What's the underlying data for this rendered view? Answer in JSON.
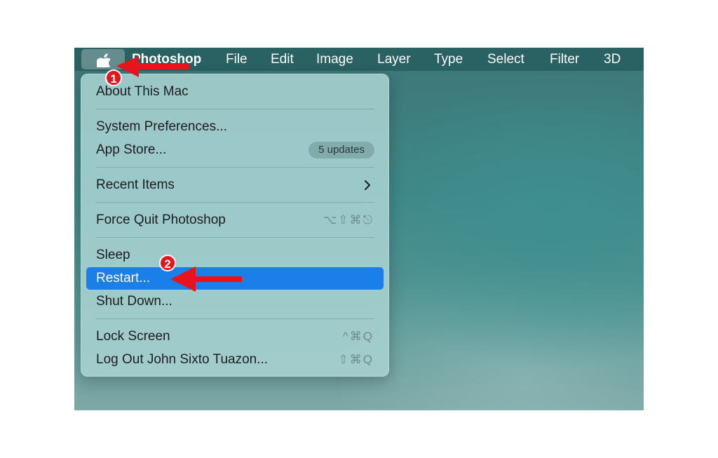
{
  "menubar": {
    "apple_icon": "apple-logo-icon",
    "app_name": "Photoshop",
    "items": [
      {
        "label": "File"
      },
      {
        "label": "Edit"
      },
      {
        "label": "Image"
      },
      {
        "label": "Layer"
      },
      {
        "label": "Type"
      },
      {
        "label": "Select"
      },
      {
        "label": "Filter"
      },
      {
        "label": "3D"
      }
    ]
  },
  "apple_menu": {
    "about": "About This Mac",
    "system_preferences": "System Preferences...",
    "app_store": "App Store...",
    "app_store_badge": "5 updates",
    "recent_items": "Recent Items",
    "force_quit": "Force Quit Photoshop",
    "force_quit_shortcut": "⌥⇧⌘⎋",
    "sleep": "Sleep",
    "restart": "Restart...",
    "shut_down": "Shut Down...",
    "lock_screen": "Lock Screen",
    "lock_screen_shortcut": "^⌘Q",
    "log_out": "Log Out John Sixto Tuazon...",
    "log_out_shortcut": "⇧⌘Q"
  },
  "annotations": {
    "step1": "1",
    "step2": "2",
    "arrow_color": "#e8141b"
  },
  "colors": {
    "highlight": "#1a7fe8",
    "menubar": "#285f61"
  }
}
